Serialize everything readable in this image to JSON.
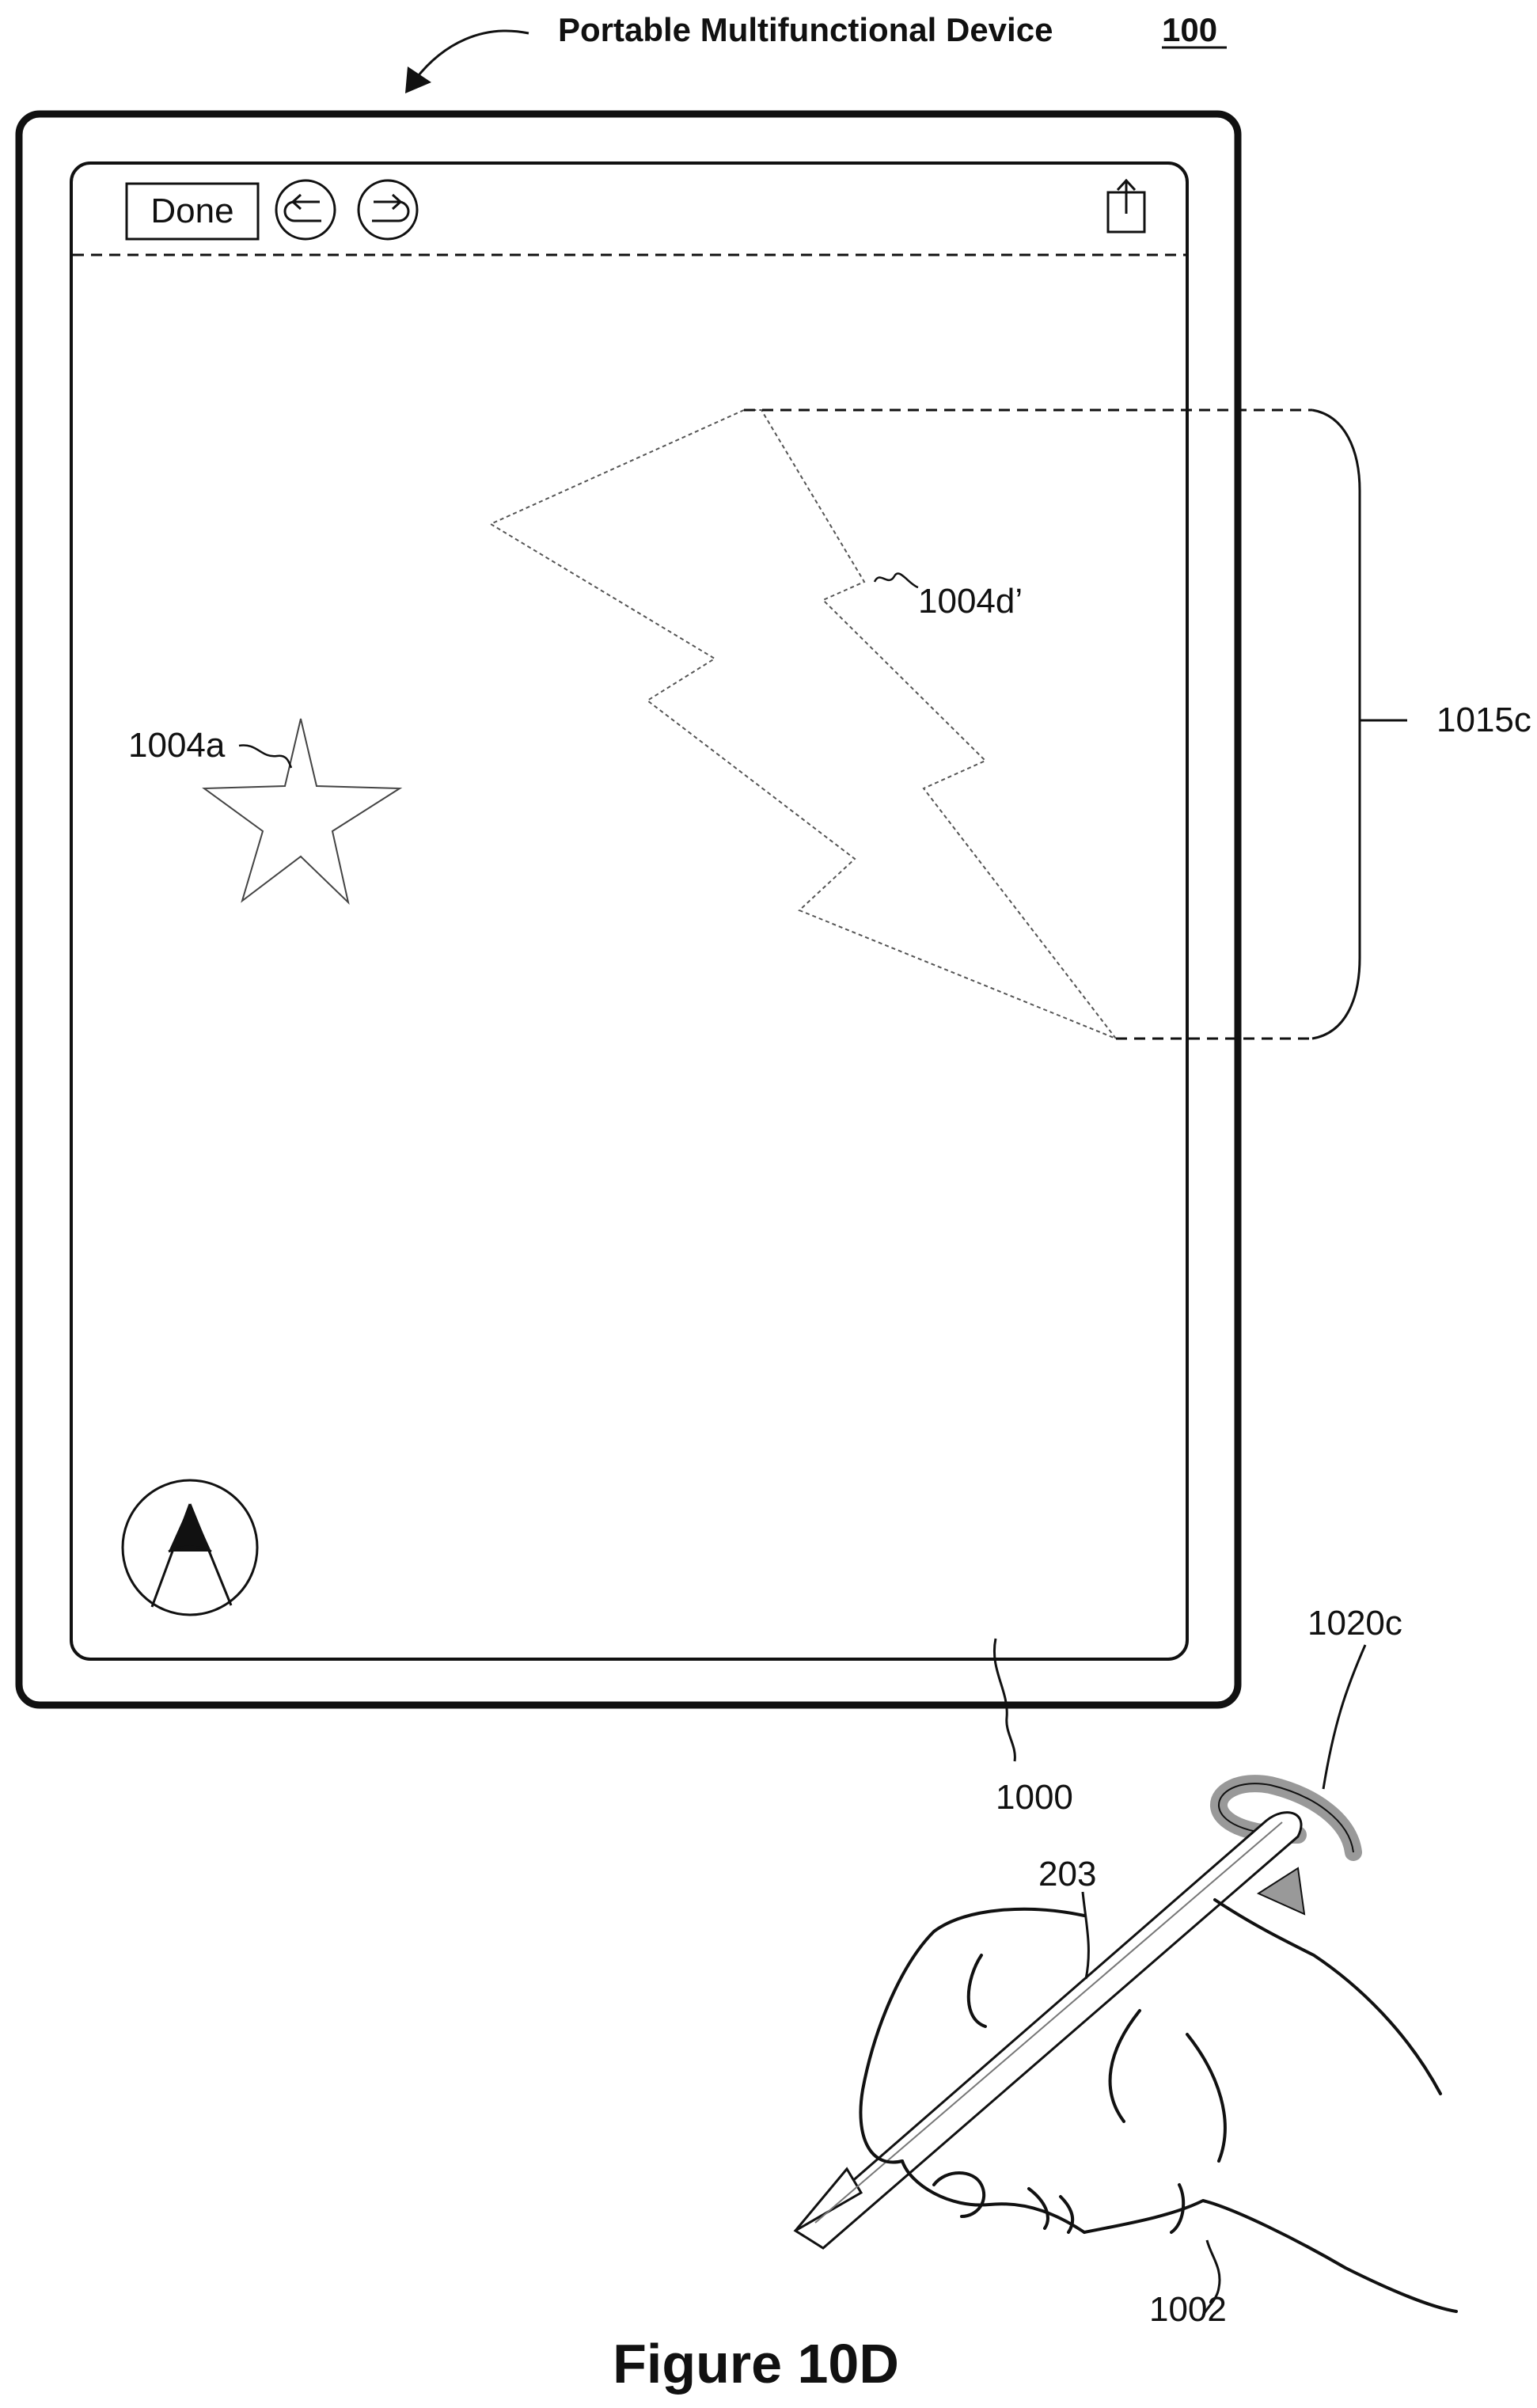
{
  "header": {
    "device_title": "Portable Multifunctional Device",
    "device_number": "100"
  },
  "toolbar": {
    "done_label": "Done",
    "undo_icon": "undo-arrow-icon",
    "redo_icon": "redo-arrow-icon",
    "share_icon": "share-icon"
  },
  "canvas_objects": {
    "star_label": "1004a",
    "bolt_label": "1004d’",
    "pencil_tool_icon": "pencil-tip-icon"
  },
  "annotations": {
    "selection_region": "1015c",
    "display": "1000",
    "rotation_gesture": "1020c",
    "stylus": "203",
    "hand": "1002"
  },
  "figure": {
    "caption": "Figure 10D"
  }
}
